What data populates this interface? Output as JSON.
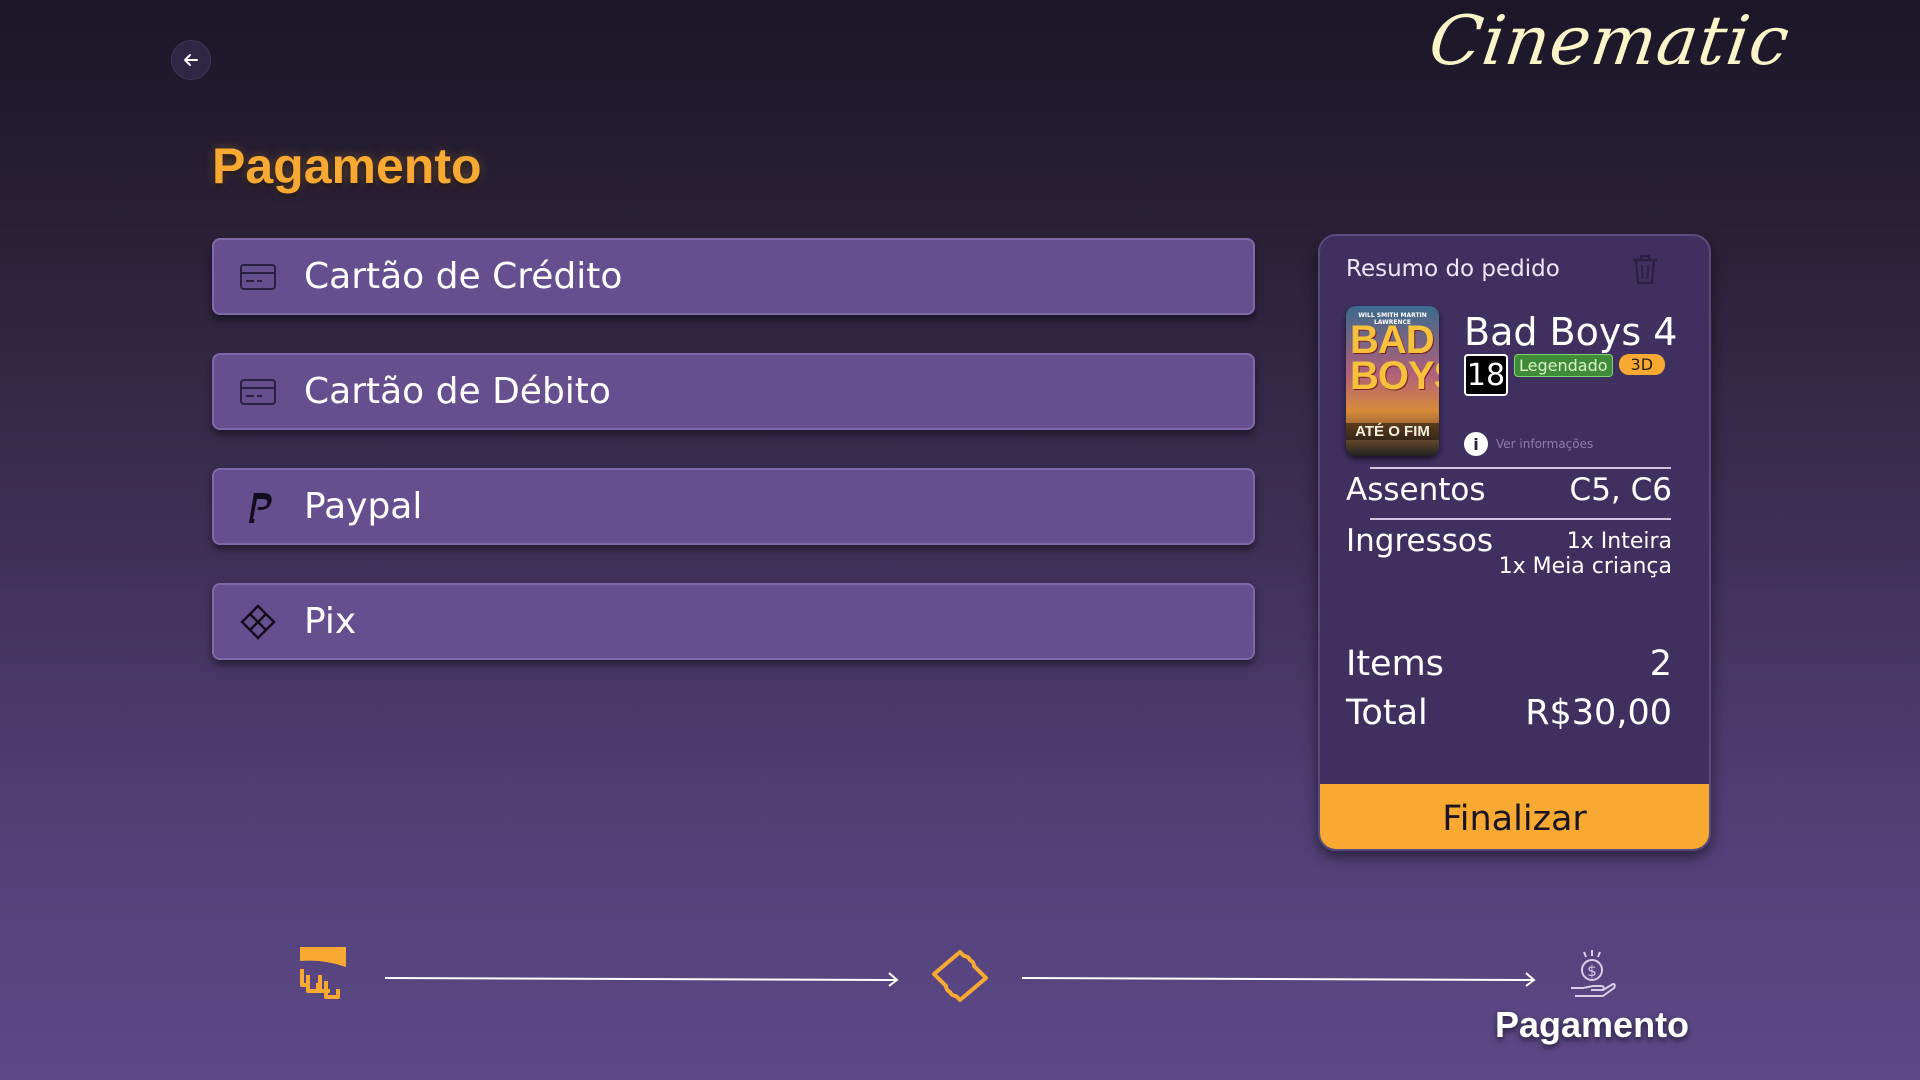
{
  "app": {
    "logo_text": "Cinematic"
  },
  "page": {
    "title": "Pagamento"
  },
  "payment_methods": [
    {
      "label": "Cartão de Crédito",
      "icon": "credit-card-icon"
    },
    {
      "label": "Cartão de Débito",
      "icon": "credit-card-icon"
    },
    {
      "label": "Paypal",
      "icon": "paypal-icon"
    },
    {
      "label": "Pix",
      "icon": "pix-icon"
    }
  ],
  "summary": {
    "title": "Resumo do pedido",
    "movie": {
      "title": "Bad Boys 4",
      "age_rating": "18",
      "language_tag": "Legendado",
      "format_tag": "3D",
      "poster_top_text": "WILL SMITH   MARTIN LAWRENCE",
      "poster_title": "BAD BOYS",
      "poster_subtitle": "ATÉ O FIM",
      "info_link": "Ver informações"
    },
    "seats_label": "Assentos",
    "seats_value": "C5, C6",
    "tickets_label": "Ingressos",
    "tickets": [
      "1x Inteira",
      "1x Meia criança"
    ],
    "items_label": "Items",
    "items_value": "2",
    "total_label": "Total",
    "total_value": "R$30,00",
    "finalize_label": "Finalizar"
  },
  "steps": [
    {
      "name": "seats",
      "icon": "seats-icon",
      "label": ""
    },
    {
      "name": "tickets",
      "icon": "ticket-icon",
      "label": ""
    },
    {
      "name": "payment",
      "icon": "payment-icon",
      "label": "Pagamento"
    }
  ],
  "colors": {
    "accent": "#f7a932",
    "card": "#664f8f",
    "panel": "#3f3060"
  }
}
